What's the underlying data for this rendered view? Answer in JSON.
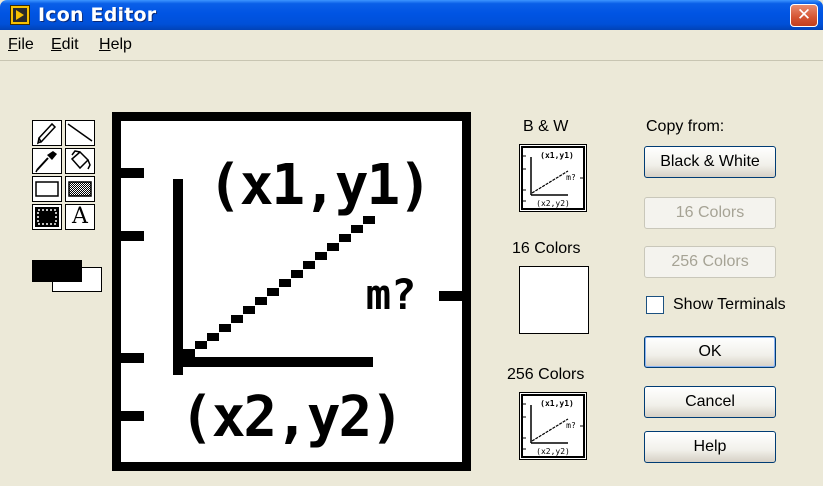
{
  "window": {
    "title": "Icon Editor",
    "close_glyph": "✕"
  },
  "menu": [
    {
      "key": "F",
      "rest": "ile"
    },
    {
      "key": "E",
      "rest": "dit"
    },
    {
      "key": "H",
      "rest": "elp"
    }
  ],
  "tools": [
    {
      "name": "pencil-tool",
      "icon": "pencil-icon"
    },
    {
      "name": "line-tool",
      "icon": "line-icon"
    },
    {
      "name": "color-copy-tool",
      "icon": "eyedropper-icon"
    },
    {
      "name": "fill-tool",
      "icon": "bucket-icon"
    },
    {
      "name": "rectangle-tool",
      "icon": "rectangle-icon"
    },
    {
      "name": "filled-rectangle-tool",
      "icon": "filled-rectangle-icon"
    },
    {
      "name": "select-tool",
      "icon": "select-icon"
    },
    {
      "name": "text-tool",
      "icon": "text-icon",
      "glyph": "A"
    }
  ],
  "canvas_text": {
    "top": "(x1,y1)",
    "side": "m?",
    "bottom": "(x2,y2)"
  },
  "preview": {
    "bw_label": "B & W",
    "c16_label": "16 Colors",
    "c256_label": "256 Colors",
    "mini_top": "(x1,y1)",
    "mini_side": "m?",
    "mini_bottom": "(x2,y2)"
  },
  "copy": {
    "label": "Copy from:",
    "bw": "Black & White",
    "c16": "16 Colors",
    "c256": "256 Colors"
  },
  "show_terminals": {
    "label": "Show Terminals",
    "checked": false
  },
  "buttons": {
    "ok": "OK",
    "cancel": "Cancel",
    "help": "Help"
  },
  "colors": {
    "title_bar": "#0054e3",
    "face": "#ece9d8",
    "close": "#d45432"
  }
}
